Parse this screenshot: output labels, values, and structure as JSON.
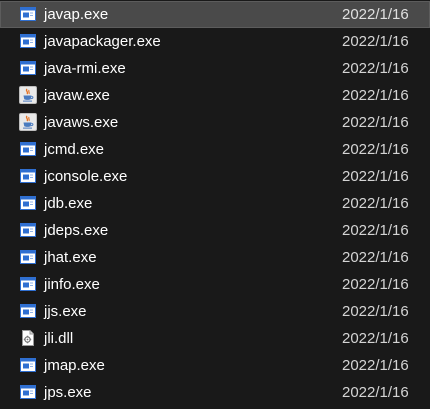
{
  "files": [
    {
      "name": "javap.exe",
      "date": "2022/1/16",
      "icon": "exe-window-icon",
      "selected": true
    },
    {
      "name": "javapackager.exe",
      "date": "2022/1/16",
      "icon": "exe-window-icon"
    },
    {
      "name": "java-rmi.exe",
      "date": "2022/1/16",
      "icon": "exe-window-icon"
    },
    {
      "name": "javaw.exe",
      "date": "2022/1/16",
      "icon": "java-cup-icon"
    },
    {
      "name": "javaws.exe",
      "date": "2022/1/16",
      "icon": "java-cup-icon"
    },
    {
      "name": "jcmd.exe",
      "date": "2022/1/16",
      "icon": "exe-window-icon"
    },
    {
      "name": "jconsole.exe",
      "date": "2022/1/16",
      "icon": "exe-window-icon"
    },
    {
      "name": "jdb.exe",
      "date": "2022/1/16",
      "icon": "exe-window-icon"
    },
    {
      "name": "jdeps.exe",
      "date": "2022/1/16",
      "icon": "exe-window-icon"
    },
    {
      "name": "jhat.exe",
      "date": "2022/1/16",
      "icon": "exe-window-icon"
    },
    {
      "name": "jinfo.exe",
      "date": "2022/1/16",
      "icon": "exe-window-icon"
    },
    {
      "name": "jjs.exe",
      "date": "2022/1/16",
      "icon": "exe-window-icon"
    },
    {
      "name": "jli.dll",
      "date": "2022/1/16",
      "icon": "dll-gear-icon"
    },
    {
      "name": "jmap.exe",
      "date": "2022/1/16",
      "icon": "exe-window-icon"
    },
    {
      "name": "jps.exe",
      "date": "2022/1/16",
      "icon": "exe-window-icon"
    }
  ],
  "colors": {
    "background": "#191919",
    "selected_row": "#4a4a4a",
    "exe_icon_blue": "#2f6fd1",
    "text": "#ffffff"
  }
}
